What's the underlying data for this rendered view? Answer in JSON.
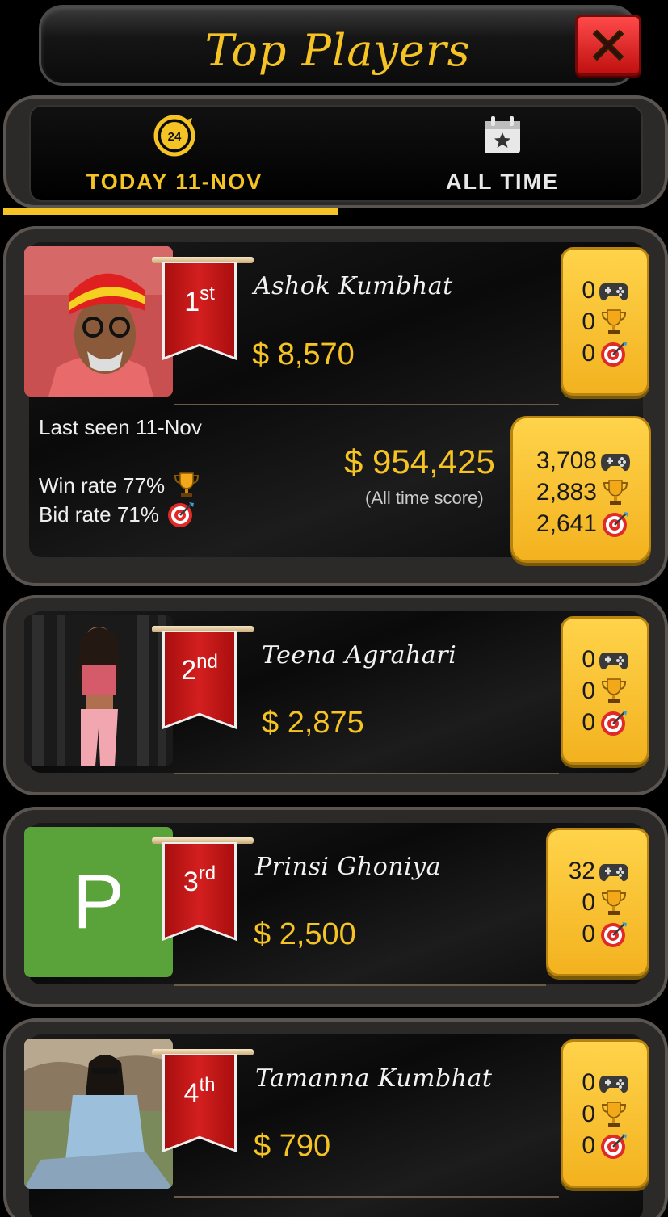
{
  "header": {
    "title": "Top Players"
  },
  "tabs": [
    {
      "label": "TODAY 11-NOV",
      "icon": "24-hours-icon",
      "active": true
    },
    {
      "label": "ALL TIME",
      "icon": "calendar-star-icon",
      "active": false
    }
  ],
  "colors": {
    "accent": "#f5c323",
    "banner": "#c8161a",
    "stat_box": "#ffc93a"
  },
  "players": [
    {
      "rank_num": "1",
      "rank_suffix": "st",
      "name": "Ashok Kumbhat",
      "score": "$ 8,570",
      "games": "0",
      "wins": "0",
      "bids": "0",
      "avatar": "photo",
      "expanded": {
        "last_seen": "Last seen 11-Nov",
        "win_rate": "Win rate 77%",
        "bid_rate": "Bid rate 71%",
        "alltime_score": "$ 954,425",
        "alltime_caption": "(All time score)",
        "alltime_games": "3,708",
        "alltime_wins": "2,883",
        "alltime_bids": "2,641"
      }
    },
    {
      "rank_num": "2",
      "rank_suffix": "nd",
      "name": "Teena Agrahari",
      "score": "$ 2,875",
      "games": "0",
      "wins": "0",
      "bids": "0",
      "avatar": "photo"
    },
    {
      "rank_num": "3",
      "rank_suffix": "rd",
      "name": "Prinsi Ghoniya",
      "score": "$ 2,500",
      "games": "32",
      "wins": "0",
      "bids": "0",
      "avatar": "P"
    },
    {
      "rank_num": "4",
      "rank_suffix": "th",
      "name": "Tamanna Kumbhat",
      "score": "$ 790",
      "games": "0",
      "wins": "0",
      "bids": "0",
      "avatar": "photo"
    }
  ]
}
